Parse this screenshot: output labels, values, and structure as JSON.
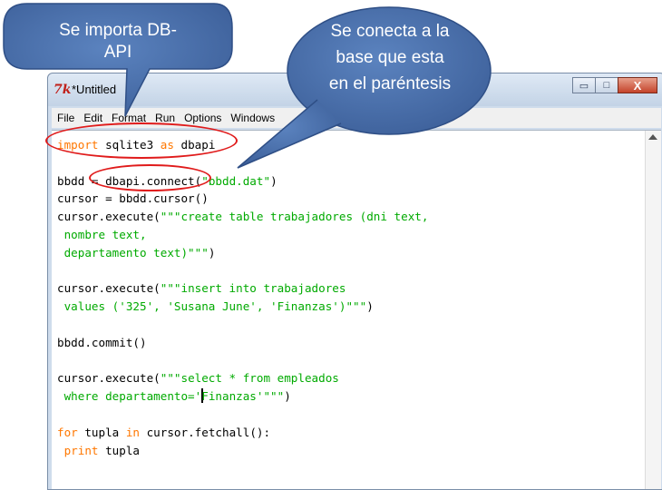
{
  "window": {
    "title": "*Untitled",
    "minimize_glyph": "▭",
    "maximize_glyph": "□",
    "close_glyph": "X"
  },
  "menu": [
    "File",
    "Edit",
    "Format",
    "Run",
    "Options",
    "Windows"
  ],
  "annotations": {
    "left_bubble": "Se importa DB-API",
    "right_bubble": "Se conecta a la base que esta en el paréntesis",
    "bubble_fill": "#4a6fa8",
    "ellipse_color": "#e01b1b"
  },
  "code": {
    "l1a": "import",
    "l1b": " sqlite3 ",
    "l1c": "as",
    "l1d": " dbapi",
    "l3a": "bbdd = dbapi.connect(",
    "l3b": "\"bbdd.dat\"",
    "l3c": ")",
    "l4": "cursor = bbdd.cursor()",
    "l5a": "cursor.execute(",
    "l5b": "\"\"\"create table trabajadores (dni text,",
    "l6": " nombre text,",
    "l7": " departamento text)\"\"\"",
    "l7c": ")",
    "l9a": "cursor.execute(",
    "l9b": "\"\"\"insert into trabajadores",
    "l10": " values ('325', 'Susana June', 'Finanzas')\"\"\"",
    "l10c": ")",
    "l12": "bbdd.commit()",
    "l14a": "cursor.execute(",
    "l14b": "\"\"\"select * from empleados",
    "l15a": " where departamento='",
    "l15b": "Finanzas'\"\"\"",
    "l15c": ")",
    "l17a": "for",
    "l17b": " tupla ",
    "l17c": "in",
    "l17d": " cursor.fetchall():",
    "l18a": " print",
    "l18b": " tupla"
  }
}
